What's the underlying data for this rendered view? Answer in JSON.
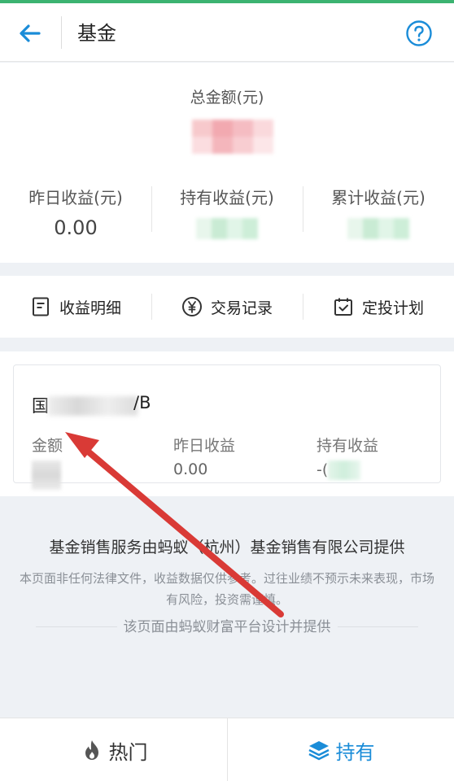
{
  "header": {
    "title": "基金",
    "back_icon": "arrow-left-icon",
    "help_icon": "question-circle-icon",
    "accent": "#1a8cd8"
  },
  "summary": {
    "total_label": "总金额(元)",
    "stats": [
      {
        "label": "昨日收益(元)",
        "value": "0.00"
      },
      {
        "label": "持有收益(元)",
        "value": ""
      },
      {
        "label": "累计收益(元)",
        "value": ""
      }
    ]
  },
  "menu": {
    "items": [
      {
        "label": "收益明细",
        "icon": "document-icon"
      },
      {
        "label": "交易记录",
        "icon": "yen-circle-icon"
      },
      {
        "label": "定投计划",
        "icon": "calendar-check-icon"
      }
    ]
  },
  "fund": {
    "name_prefix": "国",
    "name_suffix": "/B",
    "columns": [
      {
        "label": "金额",
        "value": ""
      },
      {
        "label": "昨日收益",
        "value": "0.00"
      },
      {
        "label": "持有收益",
        "value": "-("
      }
    ]
  },
  "footer": {
    "company": "基金销售服务由蚂蚁（杭州）基金销售有限公司提供",
    "disclaimer": "本页面非任何法律文件，收益数据仅供参考。过往业绩不预示未来表现，市场有风险，投资需谨慎。",
    "platform": "该页面由蚂蚁财富平台设计并提供"
  },
  "tabbar": {
    "tabs": [
      {
        "label": "热门",
        "icon": "flame-icon",
        "active": false
      },
      {
        "label": "持有",
        "icon": "layers-icon",
        "active": true
      }
    ],
    "active_color": "#1a8cd8"
  }
}
